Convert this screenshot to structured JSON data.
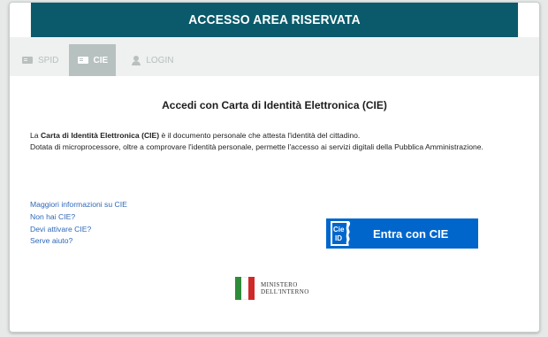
{
  "header": {
    "title": "ACCESSO AREA RISERVATA"
  },
  "tabs": [
    {
      "label": "SPID",
      "icon": "id-card-icon",
      "active": false
    },
    {
      "label": "CIE",
      "icon": "id-card-icon",
      "active": true
    },
    {
      "label": "LOGIN",
      "icon": "user-icon",
      "active": false
    }
  ],
  "main": {
    "title": "Accedi con Carta di Identità Elettronica (CIE)",
    "desc_prefix": "La ",
    "desc_bold": "Carta di Identità Elettronica (CIE)",
    "desc_rest": " è il documento personale che attesta l'identità del cittadino.",
    "desc_line2": "Dotata di microprocessore, oltre a comprovare l'identità personale, permette l'accesso ai servizi digitali della Pubblica Amministrazione."
  },
  "links": [
    "Maggiori informazioni su CIE",
    "Non hai CIE?",
    "Devi attivare CIE?",
    "Serve aiuto?"
  ],
  "cie_button": {
    "label": "Entra con CIE",
    "logo_text_top": "Cie",
    "logo_text_bottom": "ID"
  },
  "ministero": {
    "line1": "MINISTERO",
    "line2": "DELL'INTERNO"
  },
  "colors": {
    "header": "#0a5a6b",
    "tab_active": "#b7c1c0",
    "link": "#2f68b8",
    "cie_button": "#0066cc"
  }
}
